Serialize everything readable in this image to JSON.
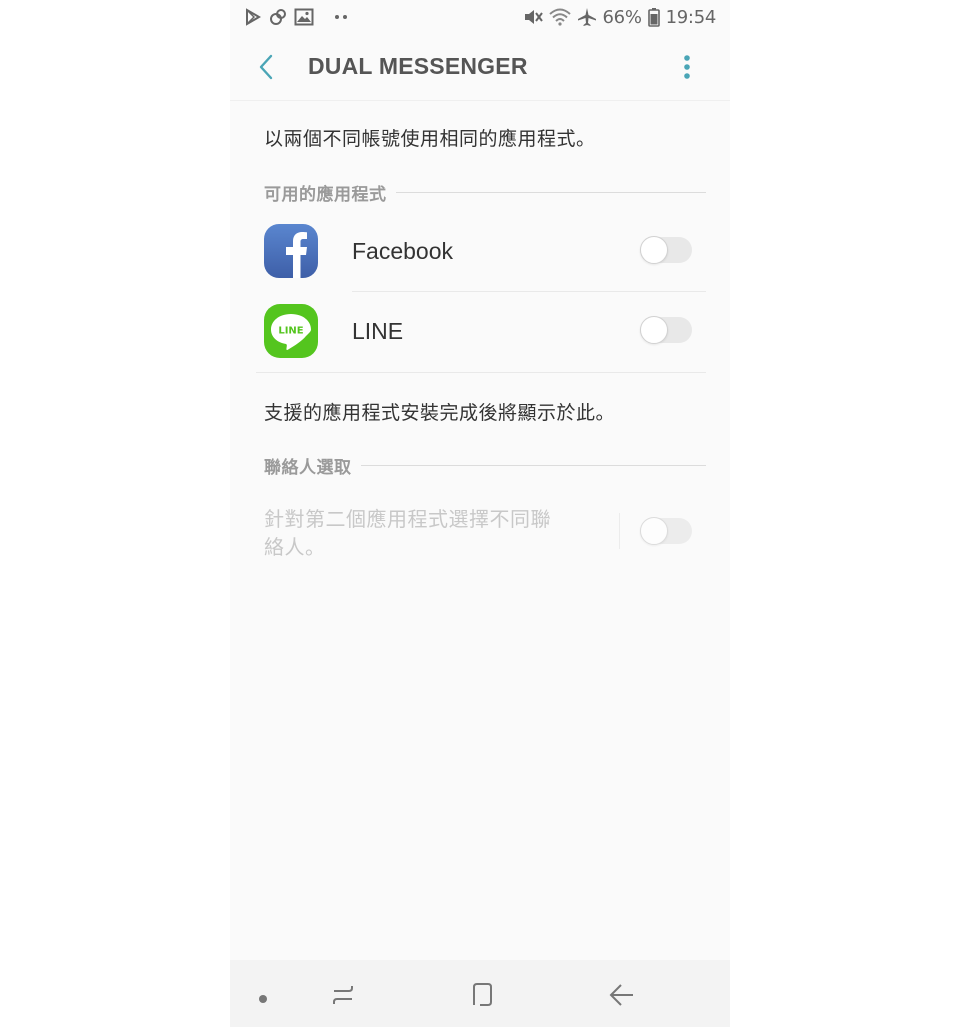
{
  "status_bar": {
    "battery_percent": "66%",
    "time": "19:54",
    "left_icons": [
      "play-store-icon",
      "link-icon",
      "image-icon",
      "more-dots-icon"
    ],
    "right_icons": [
      "mute-icon",
      "wifi-icon",
      "airplane-icon",
      "battery-icon"
    ]
  },
  "app_bar": {
    "title": "DUAL MESSENGER",
    "accent_color": "#4aa5b6"
  },
  "main": {
    "description": "以兩個不同帳號使用相同的應用程式。",
    "available_section_label": "可用的應用程式",
    "apps": [
      {
        "name": "Facebook",
        "icon": "facebook-icon",
        "enabled": false
      },
      {
        "name": "LINE",
        "icon": "line-icon",
        "enabled": false,
        "icon_text": "LINE"
      }
    ],
    "support_note": "支援的應用程式安裝完成後將顯示於此。",
    "contacts_section_label": "聯絡人選取",
    "contacts_option_text": "針對第二個應用程式選擇不同聯絡人。",
    "contacts_option_enabled": false
  },
  "nav_bar": {
    "items": [
      "dot-icon",
      "recent-apps-icon",
      "home-icon",
      "back-arrow-icon"
    ]
  },
  "colors": {
    "facebook_blue": "#4a6fb5",
    "line_green": "#54c51e",
    "background": "#fafafa"
  }
}
